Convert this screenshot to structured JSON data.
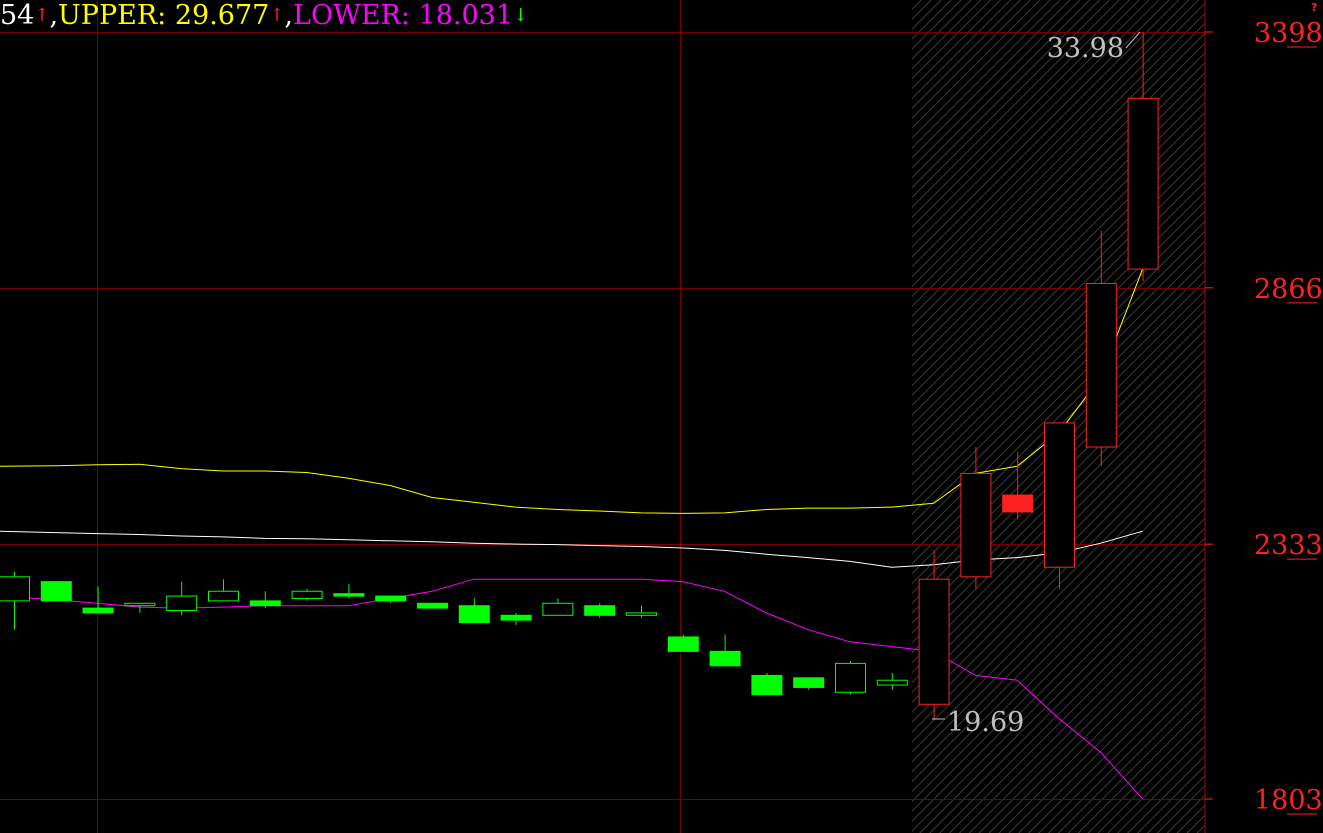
{
  "header": {
    "mid_fragment": "54",
    "sep1": ",",
    "upper_text": "UPPER: 29.677",
    "sep2": ",",
    "lower_text": "LOWER: 18.031"
  },
  "annotations": {
    "high_label": "33.98",
    "low_label": "19.69",
    "corner_mark": "?"
  },
  "colors": {
    "background": "#000000",
    "grid": "#7a0000",
    "up_candle": "#ff2020",
    "down_candle": "#00ff00",
    "mid_band": "#ffffff",
    "upper_band": "#ffff00",
    "lower_band": "#ff00ff",
    "axis_text": "#ff2020",
    "annotation_text": "#c0c0c0"
  },
  "chart_data": {
    "type": "candlestick",
    "indicator": "BOLL",
    "y_ticks": [
      {
        "label": "3398",
        "value": 33.98
      },
      {
        "label": "2866",
        "value": 28.66
      },
      {
        "label": "2333",
        "value": 23.33
      },
      {
        "label": "1803",
        "value": 18.03
      }
    ],
    "ylim": [
      17.9,
      34.1
    ],
    "candles": [
      {
        "open": 22.15,
        "close": 22.65,
        "high": 22.75,
        "low": 21.55,
        "color": "green",
        "fill": "hollow"
      },
      {
        "open": 22.55,
        "close": 22.15,
        "high": 22.55,
        "low": 22.15,
        "color": "green",
        "fill": "solid"
      },
      {
        "open": 22.0,
        "close": 21.9,
        "high": 22.45,
        "low": 21.9,
        "color": "green",
        "fill": "solid"
      },
      {
        "open": 22.05,
        "close": 22.1,
        "high": 22.1,
        "low": 21.9,
        "color": "green",
        "fill": "hollow"
      },
      {
        "open": 21.95,
        "close": 22.25,
        "high": 22.55,
        "low": 21.85,
        "color": "green",
        "fill": "hollow"
      },
      {
        "open": 22.15,
        "close": 22.35,
        "high": 22.6,
        "low": 22.15,
        "color": "green",
        "fill": "hollow"
      },
      {
        "open": 22.15,
        "close": 22.05,
        "high": 22.35,
        "low": 22.0,
        "color": "green",
        "fill": "solid"
      },
      {
        "open": 22.2,
        "close": 22.35,
        "high": 22.4,
        "low": 22.15,
        "color": "green",
        "fill": "hollow"
      },
      {
        "open": 22.3,
        "close": 22.25,
        "high": 22.5,
        "low": 22.2,
        "color": "green",
        "fill": "solid"
      },
      {
        "open": 22.25,
        "close": 22.15,
        "high": 22.25,
        "low": 22.1,
        "color": "green",
        "fill": "solid"
      },
      {
        "open": 22.1,
        "close": 22.0,
        "high": 22.1,
        "low": 22.0,
        "color": "green",
        "fill": "solid"
      },
      {
        "open": 22.05,
        "close": 21.7,
        "high": 22.2,
        "low": 21.7,
        "color": "green",
        "fill": "solid"
      },
      {
        "open": 21.85,
        "close": 21.75,
        "high": 21.9,
        "low": 21.65,
        "color": "green",
        "fill": "solid"
      },
      {
        "open": 21.85,
        "close": 22.1,
        "high": 22.2,
        "low": 21.85,
        "color": "green",
        "fill": "hollow"
      },
      {
        "open": 22.05,
        "close": 21.85,
        "high": 22.1,
        "low": 21.8,
        "color": "green",
        "fill": "solid"
      },
      {
        "open": 21.85,
        "close": 21.9,
        "high": 22.05,
        "low": 21.8,
        "color": "green",
        "fill": "hollow"
      },
      {
        "open": 21.4,
        "close": 21.1,
        "high": 21.45,
        "low": 21.1,
        "color": "green",
        "fill": "solid"
      },
      {
        "open": 21.1,
        "close": 20.8,
        "high": 21.45,
        "low": 20.8,
        "color": "green",
        "fill": "solid"
      },
      {
        "open": 20.6,
        "close": 20.2,
        "high": 20.65,
        "low": 20.2,
        "color": "green",
        "fill": "solid"
      },
      {
        "open": 20.55,
        "close": 20.35,
        "high": 20.55,
        "low": 20.3,
        "color": "green",
        "fill": "solid"
      },
      {
        "open": 20.25,
        "close": 20.85,
        "high": 20.9,
        "low": 20.2,
        "color": "green",
        "fill": "hollow"
      },
      {
        "open": 20.4,
        "close": 20.5,
        "high": 20.65,
        "low": 20.3,
        "color": "green",
        "fill": "hollow"
      },
      {
        "open": 20.0,
        "close": 22.6,
        "high": 23.2,
        "low": 19.69,
        "color": "red",
        "fill": "hollow"
      },
      {
        "open": 22.65,
        "close": 24.8,
        "high": 25.35,
        "low": 22.4,
        "color": "red",
        "fill": "hollow"
      },
      {
        "open": 24.0,
        "close": 24.35,
        "high": 25.25,
        "low": 23.85,
        "color": "red",
        "fill": "solid"
      },
      {
        "open": 22.85,
        "close": 25.85,
        "high": 25.85,
        "low": 22.4,
        "color": "red",
        "fill": "hollow"
      },
      {
        "open": 25.35,
        "close": 28.75,
        "high": 29.85,
        "low": 24.95,
        "color": "red",
        "fill": "hollow"
      },
      {
        "open": 29.05,
        "close": 32.6,
        "high": 33.98,
        "low": 28.8,
        "color": "red",
        "fill": "hollow"
      }
    ],
    "series": [
      {
        "name": "UPPER",
        "values": [
          24.95,
          24.96,
          24.98,
          24.99,
          24.9,
          24.85,
          24.85,
          24.82,
          24.7,
          24.55,
          24.3,
          24.2,
          24.1,
          24.05,
          24.02,
          23.98,
          23.97,
          23.98,
          24.05,
          24.08,
          24.08,
          24.1,
          24.18,
          24.8,
          24.95,
          25.65,
          26.8,
          29.05
        ]
      },
      {
        "name": "MID",
        "values": [
          23.6,
          23.57,
          23.55,
          23.53,
          23.5,
          23.48,
          23.45,
          23.44,
          23.42,
          23.4,
          23.38,
          23.35,
          23.33,
          23.32,
          23.3,
          23.28,
          23.25,
          23.2,
          23.12,
          23.05,
          22.97,
          22.85,
          22.9,
          23.0,
          23.05,
          23.15,
          23.35,
          23.6
        ]
      },
      {
        "name": "LOWER",
        "values": [
          22.25,
          22.17,
          22.1,
          22.02,
          22.0,
          22.02,
          22.05,
          22.05,
          22.05,
          22.2,
          22.35,
          22.6,
          22.6,
          22.6,
          22.6,
          22.6,
          22.55,
          22.35,
          21.9,
          21.55,
          21.3,
          21.2,
          21.1,
          20.6,
          20.5,
          19.7,
          19.0,
          18.03
        ]
      }
    ],
    "hatched_region_start_index": 22
  }
}
